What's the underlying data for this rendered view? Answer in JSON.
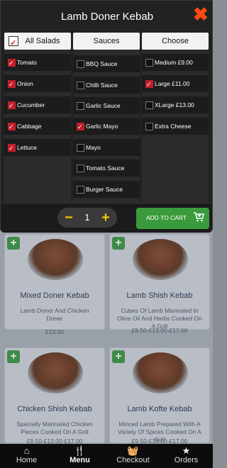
{
  "modal": {
    "title": "Lamb Doner Kebab",
    "columns": [
      {
        "header": "All Salads",
        "header_checked": true,
        "options": [
          {
            "label": "Tomato",
            "checked": true
          },
          {
            "label": "Onion",
            "checked": true
          },
          {
            "label": "Cucumber",
            "checked": true
          },
          {
            "label": "Cabbage",
            "checked": true
          },
          {
            "label": "Lettuce",
            "checked": true
          }
        ]
      },
      {
        "header": "Sauces",
        "options": [
          {
            "label": "BBQ Sauce",
            "checked": false
          },
          {
            "label": "Chilli Sauce",
            "checked": false
          },
          {
            "label": "Garlic Sauce",
            "checked": false
          },
          {
            "label": "Garlic Mayo",
            "checked": true
          },
          {
            "label": "Mayo",
            "checked": false
          },
          {
            "label": "Tomato Sauce",
            "checked": false
          },
          {
            "label": "Burger Sauce",
            "checked": false
          }
        ]
      },
      {
        "header": "Choose",
        "options": [
          {
            "label": "Medium £9.00",
            "checked": false
          },
          {
            "label": "Large £11.00",
            "checked": true
          },
          {
            "label": "XLarge £13.00",
            "checked": false
          },
          {
            "label": "Extra Cheese",
            "checked": false
          }
        ]
      }
    ],
    "quantity": "1",
    "minus": "−",
    "plus": "+",
    "add_to_cart": "ADD TO CART",
    "close_icon": "close-icon",
    "accent_color": "#ff4a14"
  },
  "menu_items": [
    {
      "name": "Mixed Doner Kebab",
      "desc": "Lamb Doner And Chicken Doner",
      "price": "£13.00"
    },
    {
      "name": "Lamb Shish Kebab",
      "desc": "Cubes Of Lamb Marinated In Olive Oil And Herbs Cooked On A Grill",
      "price": "£9.50-£13.00-£17.00"
    },
    {
      "name": "Chicken Shish Kebab",
      "desc": "Specially Marinated Chicken Pieces Cooked On A Grill",
      "price": "£9.50-£13.00-£17.00"
    },
    {
      "name": "Lamb Kofte Kebab",
      "desc": "Minced Lamb Prepared With A Variety Of Spices Cooked On A Grill",
      "price": "£9.50-£13.00-£17.00"
    }
  ],
  "nav": [
    {
      "label": "Home",
      "icon": "home-icon",
      "glyph": "⌂"
    },
    {
      "label": "Menu",
      "icon": "cutlery-icon",
      "glyph": "🍴"
    },
    {
      "label": "Checkout",
      "icon": "basket-icon",
      "glyph": "🧺"
    },
    {
      "label": "Orders",
      "icon": "star-icon",
      "glyph": "★"
    }
  ]
}
